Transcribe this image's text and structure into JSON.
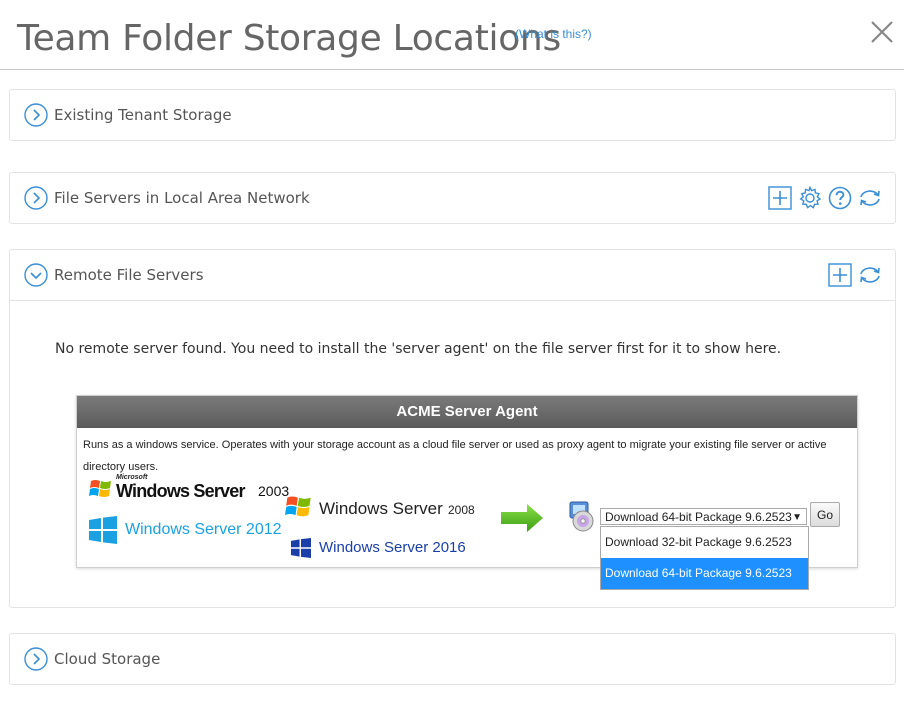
{
  "header": {
    "title": "Team Folder Storage Locations",
    "what_is_this": "(What is this?)"
  },
  "panels": [
    {
      "label": "Existing Tenant Storage"
    },
    {
      "label": "File Servers in Local Area Network"
    },
    {
      "label": "Remote File Servers"
    },
    {
      "label": "Cloud Storage"
    }
  ],
  "remote": {
    "message": "No remote server found. You need to install the 'server agent' on the file server first for it to show here.",
    "agent_title": "ACME Server Agent",
    "agent_desc": "Runs as a windows service. Operates with your storage account as a cloud file server or used as proxy agent to migrate your existing file server or active directory users.",
    "logos": {
      "ws2003_ms": "Microsoft",
      "ws2003": "Windows Server",
      "ws2003_ver": "2003",
      "ws2012": "Windows Server 2012",
      "ws2008": "Windows Server",
      "ws2008_ver": "2008",
      "ws2016": "Windows Server 2016"
    },
    "select_value": "Download 64-bit Package 9.6.2523",
    "go_label": "Go",
    "options": [
      "Download 32-bit Package 9.6.2523",
      "Download 64-bit Package 9.6.2523"
    ]
  },
  "colors": {
    "accent": "#3a8fd6",
    "selected": "#1e90ff",
    "arrow_green": "#4caf1c"
  }
}
